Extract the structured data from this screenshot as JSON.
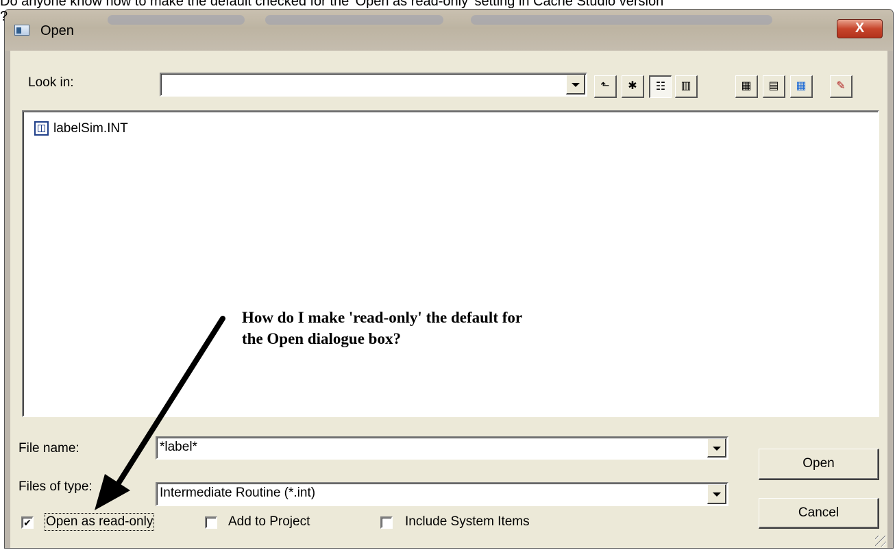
{
  "question": {
    "text": "Do anyone know how to make the default checked for the 'Open as read-only' setting in Cache Studio version",
    "continuation": "?"
  },
  "dialog": {
    "title": "Open",
    "close_glyph": "X",
    "look_in": {
      "label": "Look in:",
      "value": ""
    },
    "toolbar": [
      {
        "name": "up-folder-button",
        "glyph": "⬑"
      },
      {
        "name": "new-folder-button",
        "glyph": "✱"
      },
      {
        "name": "list-view-button",
        "glyph": "☷"
      },
      {
        "name": "details-view-button",
        "glyph": "▥"
      },
      {
        "name": "toolbar-icon-1",
        "glyph": "▦"
      },
      {
        "name": "toolbar-icon-2",
        "glyph": "▤"
      },
      {
        "name": "toolbar-icon-3",
        "glyph": "▦"
      },
      {
        "name": "toolbar-icon-4",
        "glyph": "✎"
      }
    ],
    "files": [
      {
        "name": "labelSim.INT"
      }
    ],
    "annotation": {
      "line1": "How do I make 'read-only' the default for",
      "line2": "the Open dialogue box?"
    },
    "file_name": {
      "label": "File name:",
      "value": "*label*"
    },
    "files_of_type": {
      "label": "Files of type:",
      "value": "Intermediate Routine (*.int)"
    },
    "open_button": "Open",
    "cancel_button": "Cancel",
    "options": [
      {
        "label": "Open as read-only",
        "checked": true
      },
      {
        "label": "Add to Project",
        "checked": false
      },
      {
        "label": "Include System Items",
        "checked": false
      }
    ]
  },
  "colors": {
    "dialog_face": "#ece9d8",
    "close_button": "#c7452c"
  }
}
